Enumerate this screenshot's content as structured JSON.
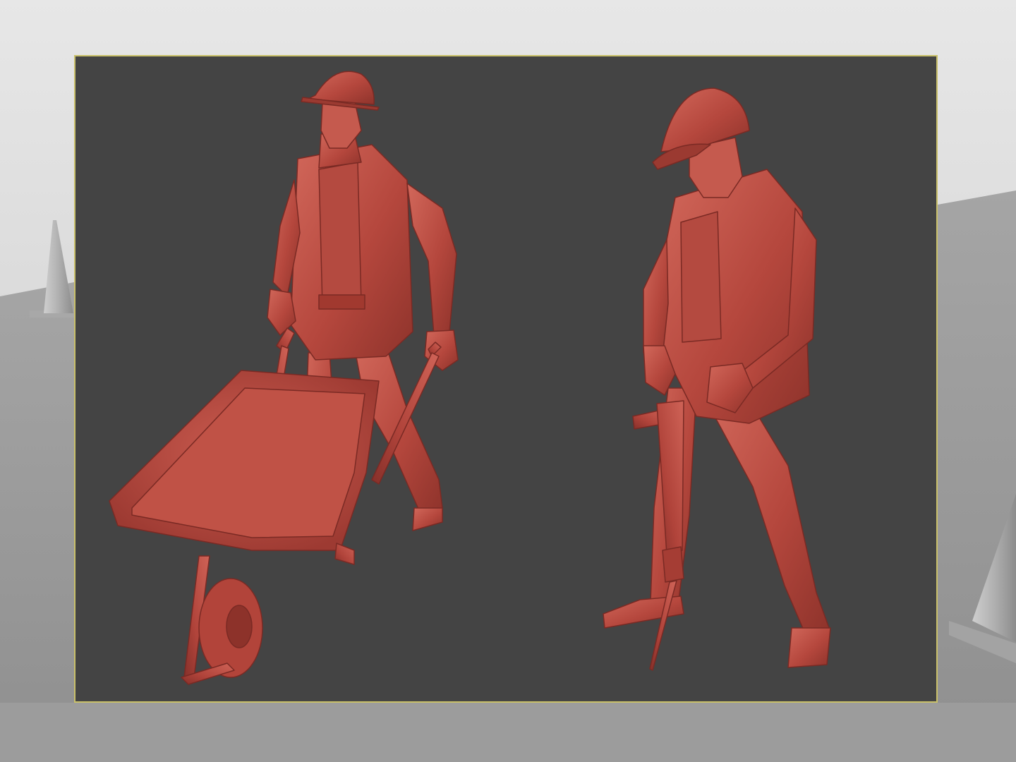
{
  "app": {
    "title": ""
  },
  "viewport": {
    "name": "perspective-viewport",
    "render_mode": "clay",
    "colors": {
      "background": "#444444",
      "frame": "#c9c06a",
      "clay": "#b5473d",
      "clay_light": "#d2685b",
      "clay_dark": "#7a2a24",
      "ground": "#9a9a9a",
      "cone": "#b9b9b9"
    }
  },
  "scene": {
    "objects": [
      {
        "name": "worker-with-wheelbarrow",
        "icon": "worker-figure",
        "props": [
          "hard-hat",
          "vest",
          "gloves",
          "wheelbarrow"
        ]
      },
      {
        "name": "worker-with-jackhammer",
        "icon": "worker-figure",
        "props": [
          "hard-hat",
          "vest",
          "gloves",
          "jackhammer"
        ]
      },
      {
        "name": "traffic-cone-left",
        "icon": "traffic-cone"
      },
      {
        "name": "traffic-cone-right",
        "icon": "traffic-cone"
      }
    ]
  }
}
